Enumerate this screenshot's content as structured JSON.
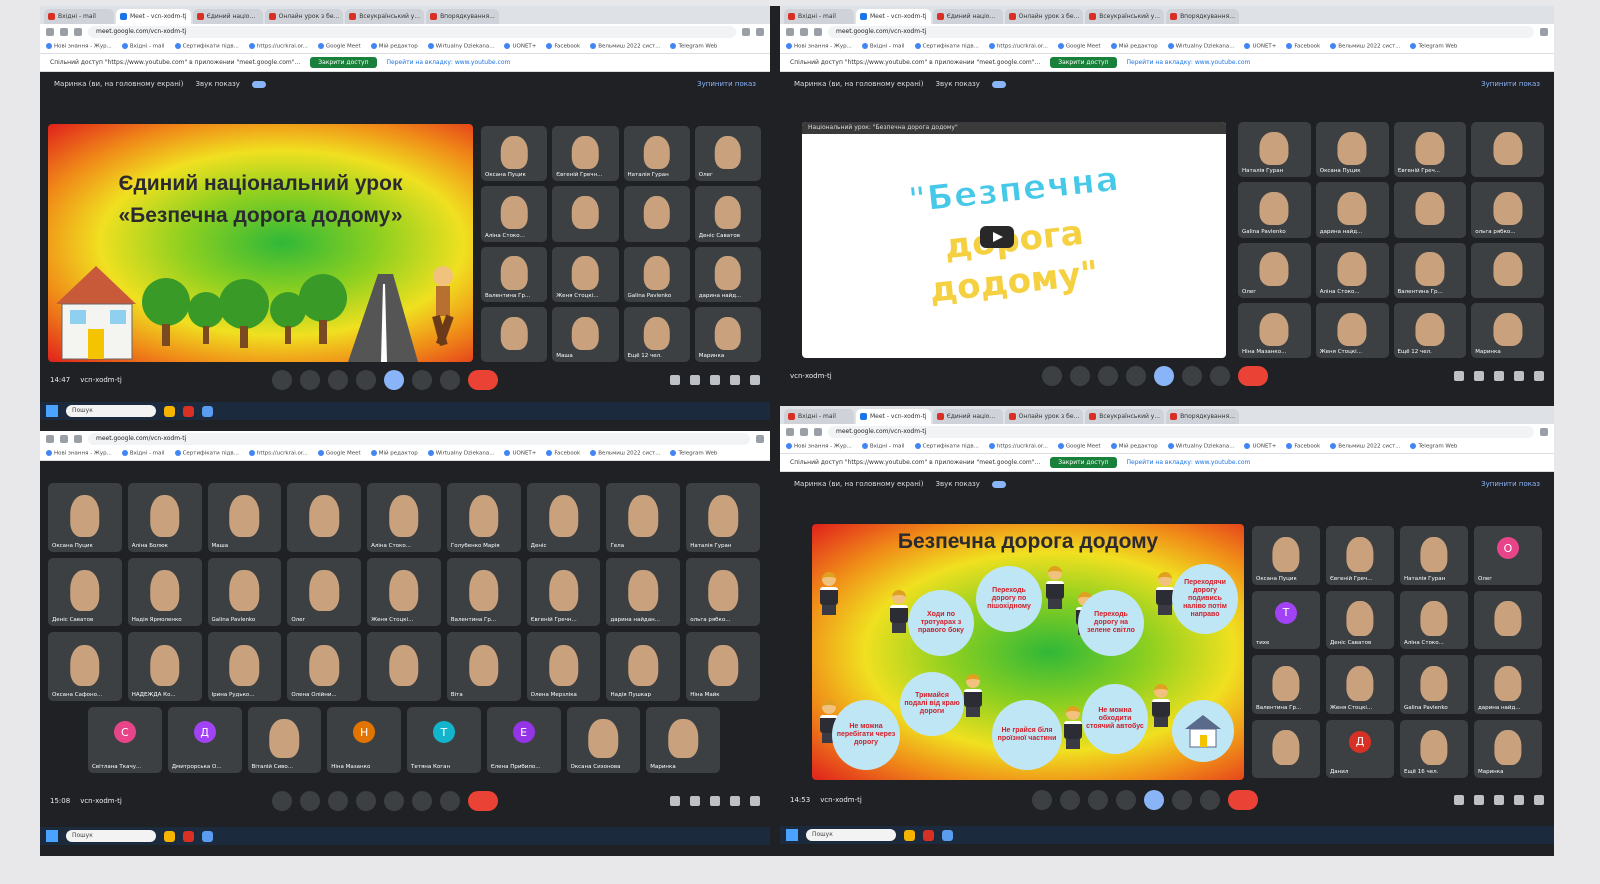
{
  "tabs": [
    "Вхідні - mail",
    "Meet - vcn-xodm-tj",
    "Єдиний націо...",
    "Онлайн урок з бе...",
    "Всеукраїнський у...",
    "Впорядкування..."
  ],
  "url": "meet.google.com/vcn-xodm-tj",
  "bookmarks": [
    "Нові знання - Жур...",
    "Вхідні - mail",
    "Сертифікати підв...",
    "https://ucrkrai.or...",
    "Google Meet",
    "Мій редактор",
    "Wirtualny Dziekana...",
    "UONET+",
    "Facebook",
    "Вельмиш 2022 сист...",
    "Telegram Web"
  ],
  "infobar": {
    "text": "Спільний доступ \"https://www.youtube.com\" в приложении \"meet.google.com\"...",
    "button": "Закрити доступ",
    "link": "Перейти на вкладку: www.youtube.com"
  },
  "presenting": {
    "label": "Маринка (ви, на головному екрані)",
    "sound": "Звук показу",
    "stop": "Зупинити показ"
  },
  "slide1": {
    "title_line1": "Єдиний національний урок",
    "title_line2": "«Безпечна дорога додому»"
  },
  "slide2": {
    "caption": "Національний урок: \"Безпечна дорога додому\"",
    "title_line1": "\"Безпечна",
    "title_line2": "дорога",
    "title_line3": "додому\""
  },
  "slide3": {
    "title": "Безпечна дорога додому",
    "bubbles": [
      "Ходи по тротуарах з правого боку",
      "Переходь дорогу по пішохідному",
      "Переходь дорогу на зелене світло",
      "Переходячи дорогу подивись наліво потім направо",
      "Тримайся подалі від краю дороги",
      "Не можна перебігати через дорогу",
      "Не грайся біля проїзної частини",
      "Не можна обходити стоячий автобус"
    ]
  },
  "q1": {
    "time": "14:47",
    "meeting": "vcn-xodm-tj",
    "tiles": [
      "Оксана Пуцик",
      "Євгеній Гречн...",
      "Наталія Гуран",
      "Олег",
      "Аліна Стоко...",
      "",
      "",
      "Деніс Саватов",
      "Валентина Гр...",
      "Женя Стоцкі...",
      "Galina Pavlenko",
      "дарина найд...",
      "",
      "Маша",
      "Ещё 12 чел.",
      "Маринка"
    ]
  },
  "q2": {
    "meeting": "vcn-xodm-tj",
    "tiles": [
      "Наталія Гуран",
      "Оксана Пуцик",
      "Євгеній Греч...",
      "",
      "Galina Pavlenko",
      "дарина найд...",
      "",
      "ольга рябко...",
      "Олег",
      "Аліна Стоко...",
      "Валентина Гр...",
      "",
      "Ніна Мазанко...",
      "Женя Стоцкі...",
      "Ещё 12 чел.",
      "Маринка"
    ]
  },
  "q3": {
    "time": "15:08",
    "meeting": "vcn-xodm-tj",
    "tiles": [
      "Оксана Пуцик",
      "Аліна Болюк",
      "Маша",
      "",
      "Аліна Стоко...",
      "Голубенко Марія",
      "Деніс",
      "Гела",
      "Наталія Гуран",
      "Деніс Саватов",
      "Надія Ярмоленко",
      "Galina Pavlenko",
      "Олег",
      "Женя Стоцкі...",
      "Валентина Гр...",
      "Євгеній Гречн...",
      "дарина найдан...",
      "ольга рябко...",
      "Оксана Сафоно...",
      "НАДЕЖДА Ко...",
      "Ірина Рудько...",
      "Олена Олійни...",
      "",
      "Віта",
      "Олена Мерзліка",
      "Надія Пушкар",
      "Ніна Майк",
      "Світлана Ткачу...",
      "Дмитрорська О...",
      "Віталій Сиво...",
      "Ніна Мазанко",
      "Тетяна Коган",
      "Єлена Прибило...",
      "Оксана Сизонова",
      "Маринка"
    ],
    "avatars": {
      "Світлана Ткачу...": "С",
      "Дмитрорська О...": "Д",
      "Ніна Мазанко": "Н",
      "Тетяна Коган": "Т",
      "Єлена Прибило...": "Е"
    }
  },
  "q4": {
    "time": "14:53",
    "meeting": "vcn-xodm-tj",
    "tiles": [
      "Оксана Пуцик",
      "Євгеній Греч...",
      "Наталія Гуран",
      "Олег",
      "тихе",
      "Деніс Саватов",
      "Аліна Стоко...",
      "",
      "Валентина Гр...",
      "Женя Стоцкі...",
      "Galina Pavlenko",
      "дарина найд...",
      "",
      "Данил",
      "Ещё 16 чел.",
      "Маринка"
    ],
    "avatars": {
      "Олег": "О",
      "тихе": "Т",
      "Данил": "Д"
    }
  },
  "taskbar": {
    "search": "Пошук"
  },
  "colors": {
    "meet_bg": "#202124",
    "tile_bg": "#3c4043",
    "accent": "#8ab4f8",
    "end_call": "#ea4335"
  }
}
